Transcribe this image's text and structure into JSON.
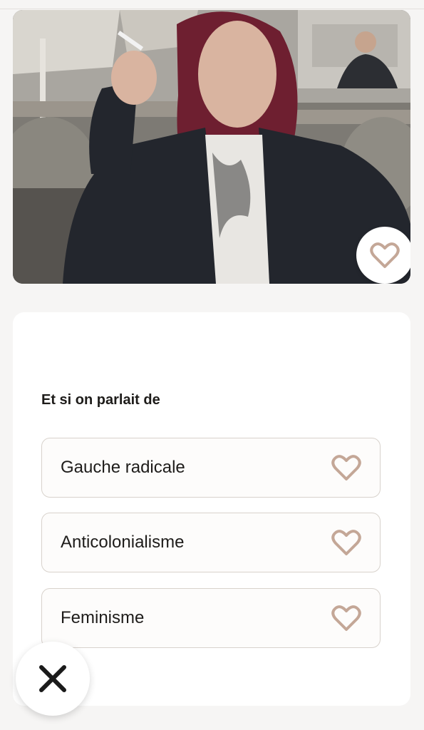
{
  "profile": {
    "photo_description_icon": "profile-photo",
    "like_icon": "heart-icon"
  },
  "conversation": {
    "prompt": "Et si on parlait de",
    "topics": [
      {
        "label": "Gauche radicale",
        "icon": "heart-icon"
      },
      {
        "label": "Anticolonialisme",
        "icon": "heart-icon"
      },
      {
        "label": "Feminisme",
        "icon": "heart-icon"
      }
    ]
  },
  "actions": {
    "dismiss_icon": "close-icon"
  },
  "colors": {
    "background": "#f6f5f4",
    "card": "#ffffff",
    "heart_accent": "#c4a797",
    "text": "#1e1c1a",
    "border": "#d8d2cc"
  }
}
